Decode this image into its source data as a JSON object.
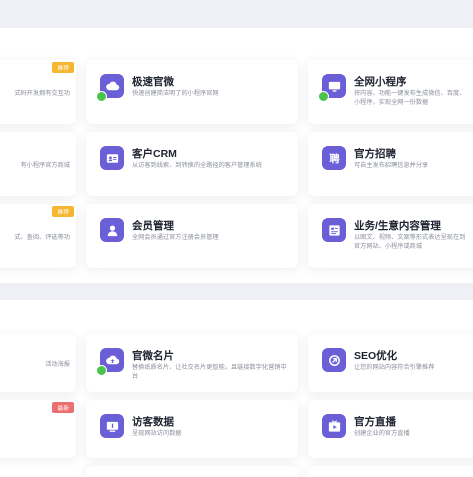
{
  "colors": {
    "accent": "#6b5fd8",
    "free_dot": "#4cc34a",
    "badge_hot": "#f5b731",
    "badge_new": "#ec6f6f"
  },
  "section1": {
    "cards": [
      {
        "icon": "cloud-icon",
        "title": "",
        "desc": "式码开发拥有交互功",
        "badge": "推荐"
      },
      {
        "icon": "cloud-icon",
        "title": "极速官微",
        "desc": "快速创建简洁明了的小程序官网"
      },
      {
        "icon": "monitor-icon",
        "title": "全网小程序",
        "desc": "将内容、功能一键发布生成微信、百度、小程序，实现全网一份数据"
      },
      {
        "icon": "",
        "title": "",
        "desc": "有小程序官方商城"
      },
      {
        "icon": "id-card-icon",
        "title": "客户CRM",
        "desc": "从访客到线索、到转换的全路径的客户管理系统"
      },
      {
        "icon": "recruit-icon",
        "title": "官方招聘",
        "desc": "可自主发布招聘信息并分享"
      },
      {
        "icon": "",
        "title": "",
        "desc": "式、查阅、评选等功",
        "badge": "推荐"
      },
      {
        "icon": "member-icon",
        "title": "会员管理",
        "desc": "全网会员通过官方注册会员管理"
      },
      {
        "icon": "content-icon",
        "title": "业务/生意内容管理",
        "desc": "以图文、视频、文案等形式表达呈现在到官方网站、小程序或商城"
      }
    ]
  },
  "section2": {
    "cards": [
      {
        "icon": "",
        "title": "",
        "desc": "活动海报"
      },
      {
        "icon": "upload-icon",
        "title": "官微名片",
        "desc": "替换纸质名片、让社交名片更智能，且链接数字化营销中台"
      },
      {
        "icon": "seo-icon",
        "title": "SEO优化",
        "desc": "让您的网站内容符合引擎推荐"
      },
      {
        "icon": "",
        "title": "",
        "desc": "",
        "badge": "最新"
      },
      {
        "icon": "visitor-icon",
        "title": "访客数据",
        "desc": "呈现网站访问数据"
      },
      {
        "icon": "live-icon",
        "title": "官方直播",
        "desc": "创建企业的官方直播"
      }
    ]
  }
}
